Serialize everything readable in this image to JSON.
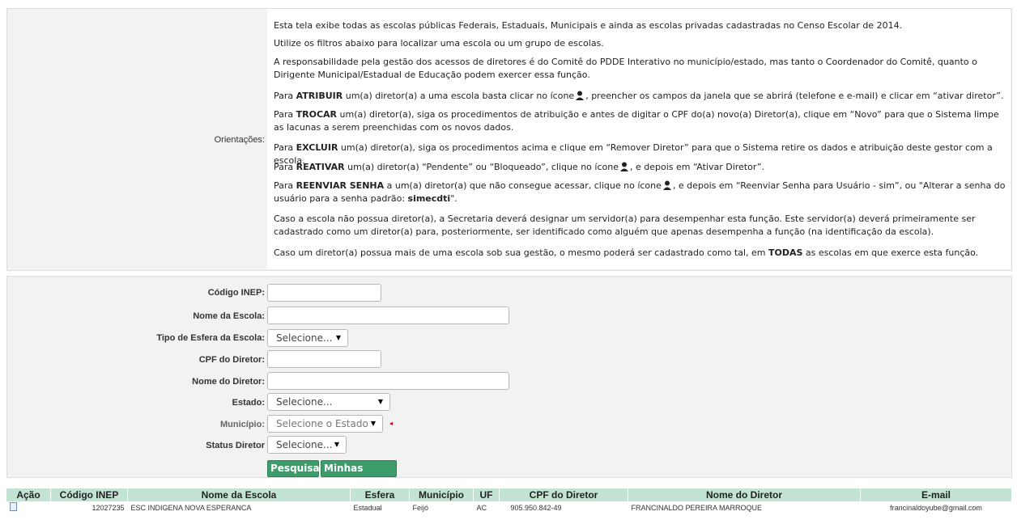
{
  "orientacoes": {
    "label": "Orientações:",
    "p1": "Esta tela exibe todas as escolas públicas Federais, Estaduais, Municipais e ainda as escolas privadas cadastradas no Censo Escolar de 2014.",
    "p2": "Utilize os filtros abaixo para localizar uma escola ou um grupo de escolas.",
    "p3": "A responsabilidade pela gestão dos acessos de diretores é do Comitê do PDDE Interativo no município/estado, mas tanto o Coordenador do Comitê, quanto o Dirigente Municipal/Estadual de Educação podem exercer essa função.",
    "p4_pre": "Para ",
    "p4_bold": "ATRIBUIR",
    "p4_a": " um(a) diretor(a) a uma escola basta clicar no ícone",
    "p4_b": ", preencher os campos da janela que se abrirá (telefone e e-mail) e clicar em “ativar diretor”.",
    "p5_pre": "Para ",
    "p5_bold": "TROCAR",
    "p5_rest": " um(a) diretor(a), siga os procedimentos de atribuição e antes de digitar o CPF do(a) novo(a) Diretor(a), clique em “Novo” para que o Sistema limpe as lacunas a serem preenchidas com os novos dados.",
    "p6_pre": "Para ",
    "p6_bold": "EXCLUIR",
    "p6_rest": " um(a) diretor(a), siga os procedimentos acima e clique em “Remover Diretor” para que o Sistema retire os dados e atribuição deste gestor com a escola.",
    "p7_pre": "Para ",
    "p7_bold": "REATIVAR",
    "p7_a": " um(a) diretor(a) “Pendente” ou “Bloqueado”, clique no ícone",
    "p7_b": ", e depois em “Ativar Diretor”.",
    "p8_pre": "Para ",
    "p8_bold": "REENVIAR SENHA",
    "p8_a": " a um(a) diretor(a) que não consegue acessar, clique no ícone",
    "p8_b": ", e depois em “Reenviar Senha para Usuário - sim”, ou \"Alterar a senha do usuário para a senha padrão: ",
    "p8_pwd": "simecdti",
    "p8_end": "\".",
    "p9": "Caso a escola não possua diretor(a), a Secretaria deverá designar um servidor(a) para desempenhar esta função. Este servidor(a) deverá primeiramente ser cadastrado como um diretor(a) para, posteriormente, ser identificado como alguém que apenas desempenha a função (na identificação da escola).",
    "p10_pre": "Caso um diretor(a) possua mais de uma escola sob sua gestão, o mesmo poderá ser cadastrado como tal, em ",
    "p10_bold": "TODAS",
    "p10_rest": " as escolas em que exerce esta função."
  },
  "form": {
    "codigo_inep": {
      "label": "Código INEP:",
      "value": ""
    },
    "nome_escola": {
      "label": "Nome da Escola:",
      "value": ""
    },
    "tipo_esfera": {
      "label": "Tipo de Esfera da Escola:",
      "selected": "Selecione..."
    },
    "cpf_diretor": {
      "label": "CPF do Diretor:",
      "value": ""
    },
    "nome_diretor": {
      "label": "Nome do Diretor:",
      "value": ""
    },
    "estado": {
      "label": "Estado:",
      "selected": "Selecione..."
    },
    "municipio": {
      "label": "Município:",
      "selected": "Selecione o Estado"
    },
    "status": {
      "label": "Status Diretor",
      "selected": "Selecione..."
    },
    "btn_pesquisar": "Pesquisar",
    "btn_minhas": "Minhas escolas"
  },
  "table": {
    "headers": [
      "Ação",
      "Código INEP",
      "Nome da Escola",
      "Esfera",
      "Município",
      "UF",
      "CPF do Diretor",
      "Nome do Diretor",
      "E-mail"
    ],
    "rows": [
      [
        "",
        "12027235",
        "ESC INDIGENA NOVA ESPERANCA",
        "Estadual",
        "Feijó",
        "AC",
        "905.950.842-49",
        "FRANCINALDO PEREIRA MARROQUE",
        "francinaldoyube@gmail.com"
      ]
    ]
  }
}
